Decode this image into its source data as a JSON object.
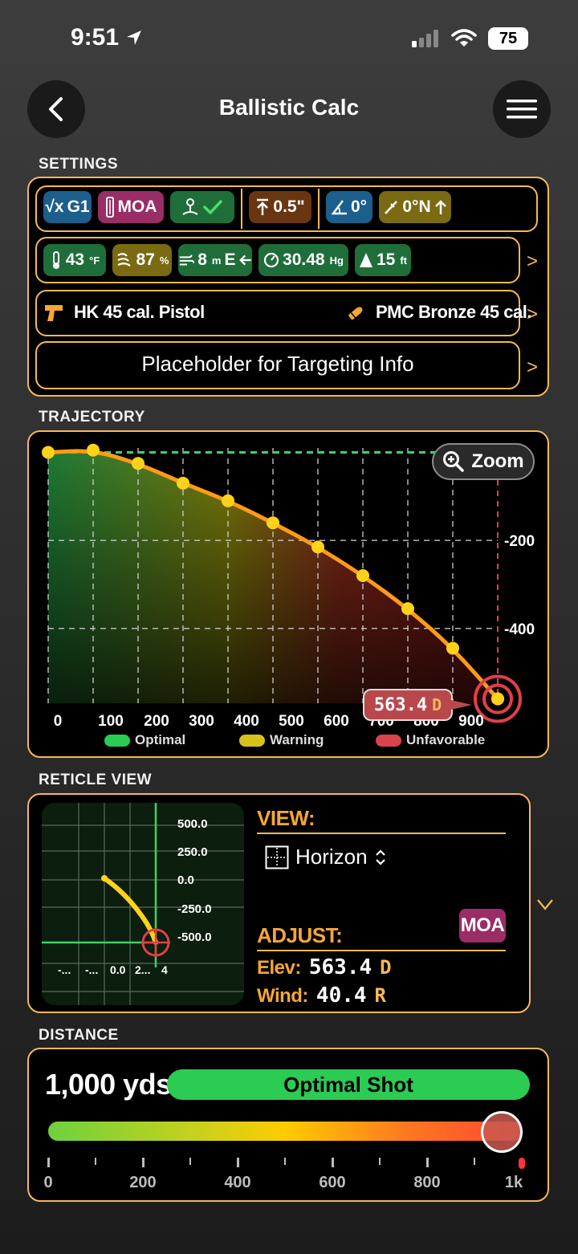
{
  "status": {
    "time": "9:51",
    "battery": "75"
  },
  "header": {
    "title": "Ballistic Calc"
  },
  "settings": {
    "label": "SETTINGS",
    "drag_model": "G1",
    "unit": "MOA",
    "scope_height": "0.5\"",
    "cant": "0°",
    "direction": "0°N",
    "temperature": {
      "value": "43",
      "unit": "°F"
    },
    "humidity": {
      "value": "87",
      "unit": "%"
    },
    "wind": {
      "value": "8",
      "unit": "m",
      "direction": "E"
    },
    "pressure": {
      "value": "30.48",
      "unit": "Hg"
    },
    "altitude": {
      "value": "15",
      "unit": "ft"
    },
    "weapon": "HK 45 cal. Pistol",
    "ammo": "PMC Bronze 45 cal.",
    "targeting_placeholder": "Placeholder for Targeting Info"
  },
  "trajectory": {
    "label": "TRAJECTORY",
    "zoom_label": "Zoom",
    "callout_value": "563.4",
    "callout_dir": "D",
    "legend": {
      "optimal": "Optimal",
      "warning": "Warning",
      "unfavorable": "Unfavorable"
    }
  },
  "chart_data": {
    "type": "line",
    "x_ticks": [
      "0",
      "100",
      "200",
      "300",
      "400",
      "500",
      "600",
      "700",
      "800",
      "900"
    ],
    "y_ticks": [
      "-200",
      "-400"
    ],
    "x": [
      0,
      100,
      200,
      300,
      400,
      500,
      600,
      700,
      800,
      900,
      1000
    ],
    "y": [
      0,
      5,
      -25,
      -70,
      -110,
      -160,
      -215,
      -280,
      -355,
      -445,
      -560
    ],
    "xlim": [
      0,
      1000
    ],
    "ylim": [
      -570,
      10
    ],
    "zero_line": 0,
    "target_x": 1000
  },
  "reticle": {
    "label": "RETICLE VIEW",
    "view_label": "VIEW:",
    "view_value": "Horizon",
    "adjust_label": "ADJUST:",
    "unit_badge": "MOA",
    "elev_label": "Elev:",
    "elev_value": "563.4",
    "elev_dir": "D",
    "wind_label": "Wind:",
    "wind_value": "40.4",
    "wind_dir": "R",
    "y_ticks": [
      "500.0",
      "250.0",
      "0.0",
      "-250.0",
      "-500.0"
    ],
    "x_ticks": [
      "-...",
      "-...",
      "0.0",
      "2...",
      "4"
    ]
  },
  "distance": {
    "label": "DISTANCE",
    "value": "1,000 yds",
    "status": "Optimal Shot",
    "slider_value": 1000,
    "slider_max": 1000,
    "tick_labels": [
      "0",
      "200",
      "400",
      "600",
      "800",
      "1k"
    ]
  }
}
